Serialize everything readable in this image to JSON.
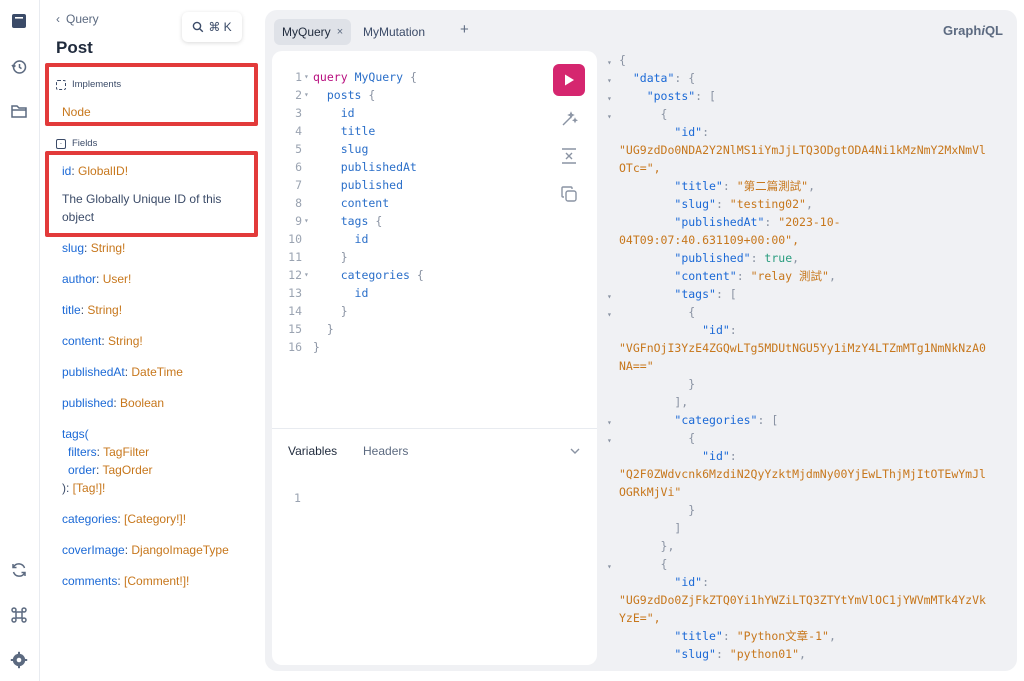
{
  "docs": {
    "back_label": "Query",
    "kbd": "⌘ K",
    "title": "Post",
    "implements_label": "Implements",
    "implements_value": "Node",
    "fields_label": "Fields",
    "id_field": {
      "name": "id",
      "type": "GlobalID!",
      "description": "The Globally Unique ID of this object"
    },
    "fields": [
      {
        "name": "slug",
        "type": "String!"
      },
      {
        "name": "author",
        "type": "User!"
      },
      {
        "name": "title",
        "type": "String!"
      },
      {
        "name": "content",
        "type": "String!"
      },
      {
        "name": "publishedAt",
        "type": "DateTime"
      },
      {
        "name": "published",
        "type": "Boolean"
      }
    ],
    "tags_field": {
      "name": "tags(",
      "arg1_name": "filters",
      "arg1_type": "TagFilter",
      "arg2_name": "order",
      "arg2_type": "TagOrder",
      "close": "): ",
      "type_open": "[",
      "type_name": "Tag",
      "type_close": "!]!"
    },
    "fields_after": [
      {
        "name": "categories",
        "type_open": "[",
        "type_name": "Category",
        "type_close": "!]!"
      },
      {
        "name": "coverImage",
        "type_open": "",
        "type_name": "DjangoImageType",
        "type_close": ""
      },
      {
        "name": "comments",
        "type_open": "[",
        "type_name": "Comment",
        "type_close": "!]!"
      }
    ]
  },
  "tabs": [
    {
      "label": "MyQuery",
      "close": "×"
    },
    {
      "label": "MyMutation"
    }
  ],
  "add_tab": "+",
  "brand_prefix": "Graph",
  "brand_italic": "i",
  "brand_suffix": "QL",
  "query_lines": [
    {
      "n": "1",
      "fold": true,
      "text": "query MyQuery {"
    },
    {
      "n": "2",
      "fold": true,
      "text": "  posts {"
    },
    {
      "n": "3",
      "fold": false,
      "text": "    id"
    },
    {
      "n": "4",
      "fold": false,
      "text": "    title"
    },
    {
      "n": "5",
      "fold": false,
      "text": "    slug"
    },
    {
      "n": "6",
      "fold": false,
      "text": "    publishedAt"
    },
    {
      "n": "7",
      "fold": false,
      "text": "    published"
    },
    {
      "n": "8",
      "fold": false,
      "text": "    content"
    },
    {
      "n": "9",
      "fold": true,
      "text": "    tags {"
    },
    {
      "n": "10",
      "fold": false,
      "text": "      id"
    },
    {
      "n": "11",
      "fold": false,
      "text": "    }"
    },
    {
      "n": "12",
      "fold": true,
      "text": "    categories {"
    },
    {
      "n": "13",
      "fold": false,
      "text": "      id"
    },
    {
      "n": "14",
      "fold": false,
      "text": "    }"
    },
    {
      "n": "15",
      "fold": false,
      "text": "  }"
    },
    {
      "n": "16",
      "fold": false,
      "text": "}"
    }
  ],
  "variables_tab": "Variables",
  "headers_tab": "Headers",
  "variables_line": "1",
  "result": {
    "line1": "{",
    "data_key": "\"data\"",
    "posts_key": "\"posts\"",
    "items": [
      {
        "id": "\"UG9zdDo0NDA2Y2NlMS1iYmJjLTQ3ODgtODA4Ni1kMzNmY2MxNmVlOTc=\"",
        "id_wrap1": "\"UG9zdDo0NDA2Y2NlMS1iYmJjLTQ3ODgtODA4Ni1kMzNmY2MxNmVl",
        "id_wrap2": "OTc=\",",
        "title": "\"第二篇測試\"",
        "slug": "\"testing02\"",
        "publishedAt_wrap1": "\"2023-10-",
        "publishedAt_wrap2": "04T09:07:40.631109+00:00\",",
        "published": "true",
        "content": "\"relay 測試\"",
        "tag_id_wrap1": "\"VGFnOjI3YzE4ZGQwLTg5MDUtNGU5Yy1iMzY4LTZmMTg1NmNkNzA0",
        "tag_id_wrap2": "NA==\"",
        "cat_id_wrap1": "\"Q2F0ZWdvcnk6MzdiN2QyYzktMjdmNy00YjEwLThjMjItOTEwYmJl",
        "cat_id_wrap2": "OGRkMjVi\""
      },
      {
        "id_wrap1": "\"UG9zdDo0ZjFkZTQ0Yi1hYWZiLTQ3ZTYtYmVlOC1jYWVmMTk4YzVk",
        "id_wrap2": "YzE=\",",
        "title": "\"Python文章-1\"",
        "slug": "\"python01\""
      }
    ]
  }
}
